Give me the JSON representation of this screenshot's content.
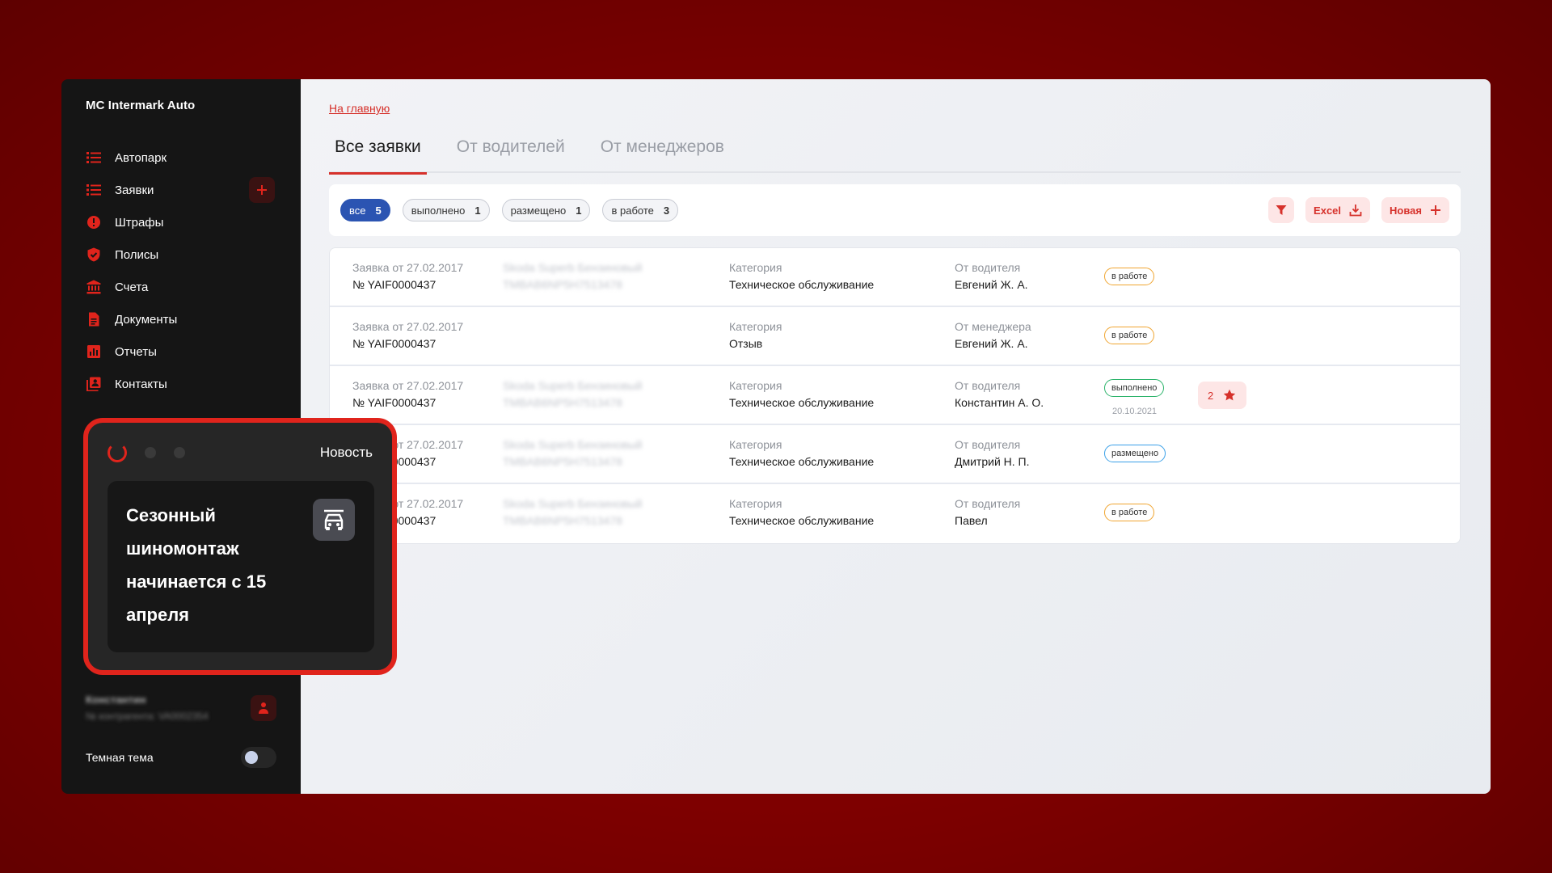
{
  "sidebar": {
    "brand": "MC Intermark Auto",
    "items": [
      {
        "label": "Автопарк",
        "icon": "list-icon"
      },
      {
        "label": "Заявки",
        "icon": "list-icon"
      },
      {
        "label": "Штрафы",
        "icon": "alert-icon"
      },
      {
        "label": "Полисы",
        "icon": "shield-icon"
      },
      {
        "label": "Счета",
        "icon": "bank-icon"
      },
      {
        "label": "Документы",
        "icon": "document-icon"
      },
      {
        "label": "Отчеты",
        "icon": "chart-icon"
      },
      {
        "label": "Контакты",
        "icon": "contacts-icon"
      }
    ],
    "user": {
      "name": "Константин",
      "id": "№ контрагента: VA0002354"
    },
    "theme_label": "Темная тема"
  },
  "main": {
    "back_link": "На главную",
    "tabs": [
      "Все заявки",
      "От водителей",
      "От менеджеров"
    ],
    "filters": [
      {
        "label": "все",
        "count": "5"
      },
      {
        "label": "выполнено",
        "count": "1"
      },
      {
        "label": "размещено",
        "count": "1"
      },
      {
        "label": "в работе",
        "count": "3"
      }
    ],
    "excel_label": "Excel",
    "new_label": "Новая",
    "rows": [
      {
        "date": "Заявка от 27.02.2017",
        "number": "№ YAIF0000437",
        "car": "Skoda Superb Бензиновый",
        "vin": "TMBAB6NP5H7513478",
        "cat_label": "Категория",
        "category": "Техническое обслуживание",
        "from_label": "От водителя",
        "from": "Евгений Ж. А.",
        "status": "в работе"
      },
      {
        "date": "Заявка от 27.02.2017",
        "number": "№ YAIF0000437",
        "car": "",
        "vin": "",
        "cat_label": "Категория",
        "category": "Отзыв",
        "from_label": "От менеджера",
        "from": "Евгений Ж. А.",
        "status": "в работе"
      },
      {
        "date": "Заявка от 27.02.2017",
        "number": "№ YAIF0000437",
        "car": "Skoda Superb Бензиновый",
        "vin": "TMBAB6NP5H7513478",
        "cat_label": "Категория",
        "category": "Техническое обслуживание",
        "from_label": "От водителя",
        "from": "Константин А. О.",
        "status": "выполнено",
        "status_date": "20.10.2021",
        "rating": "2"
      },
      {
        "date": "Заявка от 27.02.2017",
        "number": "№ YAIF0000437",
        "car": "Skoda Superb Бензиновый",
        "vin": "TMBAB6NP5H7513478",
        "cat_label": "Категория",
        "category": "Техническое обслуживание",
        "from_label": "От водителя",
        "from": "Дмитрий Н. П.",
        "status": "размещено"
      },
      {
        "date": "Заявка от 27.02.2017",
        "number": "№ YAIF0000437",
        "car": "Skoda Superb Бензиновый",
        "vin": "TMBAB6NP5H7513478",
        "cat_label": "Категория",
        "category": "Техническое обслуживание",
        "from_label": "От водителя",
        "from": "Павел",
        "status": "в работе"
      }
    ]
  },
  "news": {
    "label": "Новость",
    "text": "Сезонный шиномонтаж начинается с 15 апреля",
    "icon": "car-icon"
  },
  "colors": {
    "accent": "#d6312b",
    "active_chip": "#2b54b2",
    "status_in_work": "#f0a531",
    "status_done": "#2bb36a",
    "status_placed": "#3aa0e8"
  }
}
